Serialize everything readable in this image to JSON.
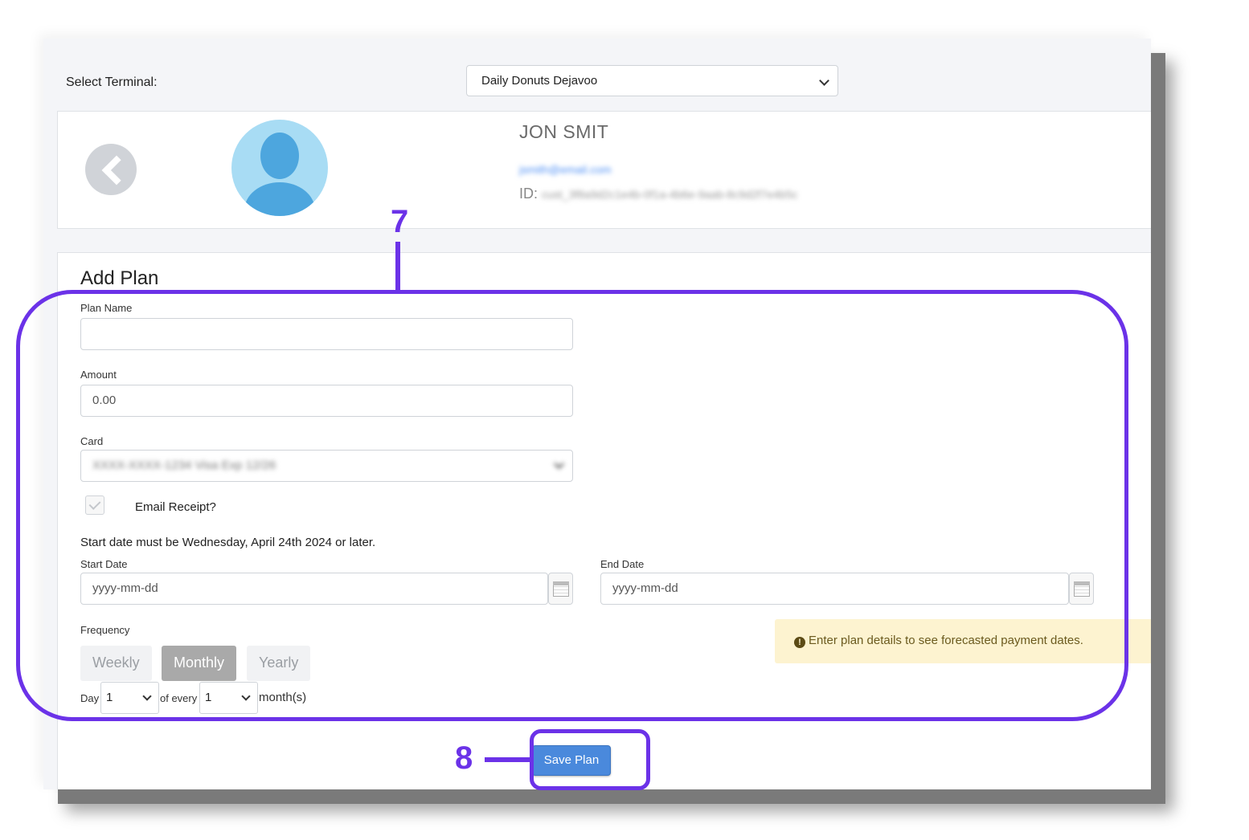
{
  "terminal": {
    "label": "Select Terminal:",
    "selected": "Daily Donuts Dejavoo"
  },
  "customer": {
    "name": "JON SMIT",
    "email": "jsmith@email.com",
    "id_label": "ID:",
    "id_value": "cust_3f8a9d2c1e4b-0f1a-4b6e-9aab-8c9d2f7e4b5c"
  },
  "plan": {
    "title": "Add Plan",
    "plan_name_label": "Plan Name",
    "plan_name_value": "",
    "amount_label": "Amount",
    "amount_value": "0.00",
    "card_label": "Card",
    "card_value": "XXXX-XXXX-1234 Visa Exp 12/26",
    "email_receipt_label": "Email Receipt?",
    "date_note": "Start date must be Wednesday, April 24th 2024 or later.",
    "start_date_label": "Start Date",
    "start_date_placeholder": "yyyy-mm-dd",
    "end_date_label": "End Date",
    "end_date_placeholder": "yyyy-mm-dd",
    "frequency_label": "Frequency",
    "frequency_options": [
      "Weekly",
      "Monthly",
      "Yearly"
    ],
    "frequency_selected": "Monthly",
    "day_label": "Day",
    "day_value": "1",
    "of_every_label": "of every",
    "every_value": "1",
    "months_label": "month(s)",
    "forecast_message": "Enter plan details to see forecasted payment dates.",
    "save_label": "Save Plan"
  },
  "annotations": {
    "step_7": "7",
    "step_8": "8",
    "color": "#6b32e8"
  },
  "colors": {
    "primary_button": "#4a89dc",
    "avatar_bg": "#a8dcf4",
    "avatar_fg": "#4da6de",
    "warning_bg": "#fdf3d0"
  }
}
